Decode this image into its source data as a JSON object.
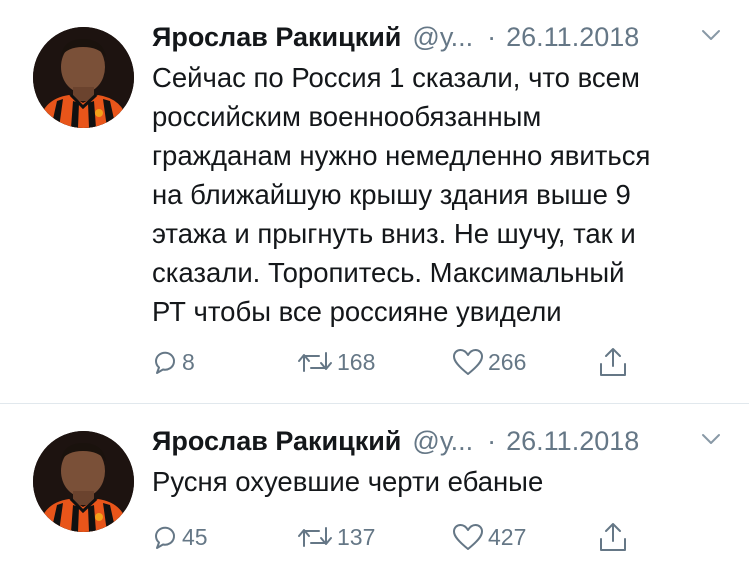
{
  "tweets": [
    {
      "author_name": "Ярослав Ракицкий",
      "handle": "@у...",
      "separator": "·",
      "date": "26.11.2018",
      "text": "Сейчас по Россия 1 сказали, что всем\nроссийским военнообязанным\nгражданам нужно немедленно явиться\nна ближайшую крышу здания выше 9\nэтажа и прыгнуть вниз. Не шучу, так и\nсказали. Торопитесь. Максимальный\nРТ чтобы все россияне увидели",
      "replies": "8",
      "retweets": "168",
      "likes": "266"
    },
    {
      "author_name": "Ярослав Ракицкий",
      "handle": "@у...",
      "separator": "·",
      "date": "26.11.2018",
      "text": "Русня охуевшие черти ебаные",
      "replies": "45",
      "retweets": "137",
      "likes": "427"
    }
  ],
  "colors": {
    "text": "#14171a",
    "secondary": "#657786",
    "divider": "#e1e8ed",
    "jersey_orange": "#e8551a",
    "jersey_black": "#111111"
  },
  "icons": [
    "reply-icon",
    "retweet-icon",
    "like-icon",
    "share-icon",
    "chevron-down-icon"
  ]
}
